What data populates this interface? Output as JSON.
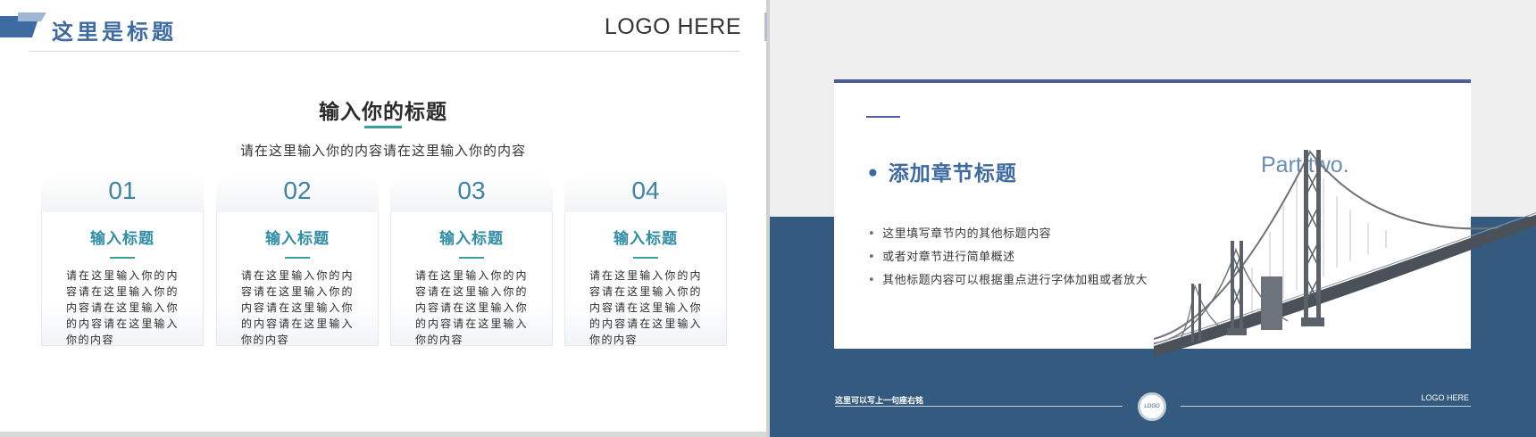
{
  "left_slide": {
    "title": "这里是标题",
    "logo": "LOGO HERE",
    "heading": "输入你的标题",
    "subheading": "请在这里输入你的内容请在这里输入你的内容",
    "cards": [
      {
        "number": "01",
        "title": "输入标题",
        "text": "请在这里输入你的内容请在这里输入你的内容请在这里输入你的内容请在这里输入你的内容"
      },
      {
        "number": "02",
        "title": "输入标题",
        "text": "请在这里输入你的内容请在这里输入你的内容请在这里输入你的内容请在这里输入你的内容"
      },
      {
        "number": "03",
        "title": "输入标题",
        "text": "请在这里输入你的内容请在这里输入你的内容请在这里输入你的内容请在这里输入你的内容"
      },
      {
        "number": "04",
        "title": "输入标题",
        "text": "请在这里输入你的内容请在这里输入你的内容请在这里输入你的内容请在这里输入你的内容"
      }
    ]
  },
  "right_slide": {
    "section_title": "• 添加章节标题",
    "part_label": "Part two.",
    "bullets": [
      "这里填写章节内的其他标题内容",
      "或者对章节进行简单概述",
      "其他标题内容可以根据重点进行字体加粗或者放大"
    ],
    "footer_motto": "这里可以写上一句座右铭",
    "footer_logo_circle": "LOGO",
    "footer_logo": "LOGO HERE",
    "image_icon": "suspension-bridge-image"
  },
  "colors": {
    "title_blue": "#3c6aa1",
    "teal_accent": "#3a9f96",
    "band_blue": "#345a80",
    "bar_purple": "#4f5c9c"
  }
}
